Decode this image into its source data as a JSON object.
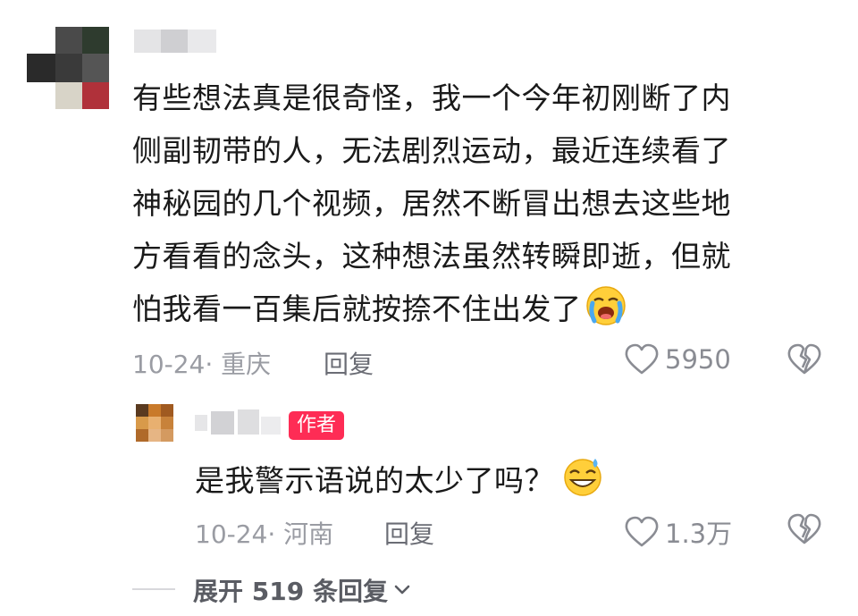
{
  "comment": {
    "lines": [
      "有些想法真是很奇怪，我一个今年初刚断了内",
      "侧副韧带的人，无法剧烈运动，最近连续看了",
      "神秘园的几个视频，居然不断冒出想去这些地",
      "方看看的念头，这种想法虽然转瞬即逝，但就",
      "怕我看一百集后就按捺不住出发了"
    ],
    "emoji": "😭",
    "date_location": "10-24· 重庆",
    "reply_label": "回复",
    "like_count": "5950"
  },
  "reply": {
    "author_badge": "作者",
    "text": "是我警示语说的太少了吗？",
    "emoji": "😅",
    "date_location": "10-24· 河南",
    "reply_label": "回复",
    "like_count": "1.3万"
  },
  "expand_label": "展开 519 条回复",
  "colors": {
    "badge": "#fe2c55",
    "muted": "#9a9ca3"
  }
}
